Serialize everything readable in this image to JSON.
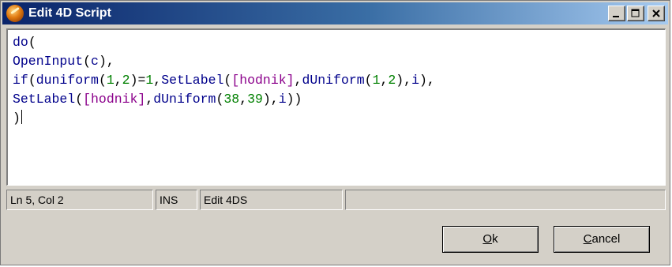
{
  "window": {
    "title": "Edit 4D Script"
  },
  "title_controls": {
    "minimize": "_",
    "maximize": "□",
    "close": "✕"
  },
  "editor": {
    "lines": [
      [
        {
          "t": "do",
          "c": "kw"
        },
        {
          "t": "(",
          "c": "pun"
        }
      ],
      [
        {
          "t": "OpenInput",
          "c": "kw"
        },
        {
          "t": "(",
          "c": "pun"
        },
        {
          "t": "c",
          "c": "kw"
        },
        {
          "t": "),",
          "c": "pun"
        }
      ],
      [
        {
          "t": "if",
          "c": "kw"
        },
        {
          "t": "(",
          "c": "pun"
        },
        {
          "t": "duniform",
          "c": "kw"
        },
        {
          "t": "(",
          "c": "pun"
        },
        {
          "t": "1",
          "c": "num"
        },
        {
          "t": ",",
          "c": "pun"
        },
        {
          "t": "2",
          "c": "num"
        },
        {
          "t": ")=",
          "c": "pun"
        },
        {
          "t": "1",
          "c": "num"
        },
        {
          "t": ",",
          "c": "pun"
        },
        {
          "t": "SetLabel",
          "c": "kw"
        },
        {
          "t": "(",
          "c": "pun"
        },
        {
          "t": "[hodnik]",
          "c": "ref"
        },
        {
          "t": ",",
          "c": "pun"
        },
        {
          "t": "dUniform",
          "c": "kw"
        },
        {
          "t": "(",
          "c": "pun"
        },
        {
          "t": "1",
          "c": "num"
        },
        {
          "t": ",",
          "c": "pun"
        },
        {
          "t": "2",
          "c": "num"
        },
        {
          "t": "),",
          "c": "pun"
        },
        {
          "t": "i",
          "c": "kw"
        },
        {
          "t": "),",
          "c": "pun"
        }
      ],
      [
        {
          "t": "SetLabel",
          "c": "kw"
        },
        {
          "t": "(",
          "c": "pun"
        },
        {
          "t": "[hodnik]",
          "c": "ref"
        },
        {
          "t": ",",
          "c": "pun"
        },
        {
          "t": "dUniform",
          "c": "kw"
        },
        {
          "t": "(",
          "c": "pun"
        },
        {
          "t": "38",
          "c": "num"
        },
        {
          "t": ",",
          "c": "pun"
        },
        {
          "t": "39",
          "c": "num"
        },
        {
          "t": "),",
          "c": "pun"
        },
        {
          "t": "i",
          "c": "kw"
        },
        {
          "t": "))",
          "c": "pun"
        }
      ],
      [
        {
          "t": ")",
          "c": "pun"
        }
      ]
    ],
    "colors": {
      "keyword": "#00008b",
      "number": "#008000",
      "reference": "#8b008b",
      "punctuation": "#000000"
    }
  },
  "status": {
    "position": "Ln 5, Col 2",
    "mode": "INS",
    "info": "Edit 4DS",
    "extra": ""
  },
  "buttons": {
    "ok": "Ok",
    "ok_mnemonic": "O",
    "ok_rest": "k",
    "cancel": "Cancel",
    "cancel_mnemonic": "C",
    "cancel_rest": "ancel"
  }
}
